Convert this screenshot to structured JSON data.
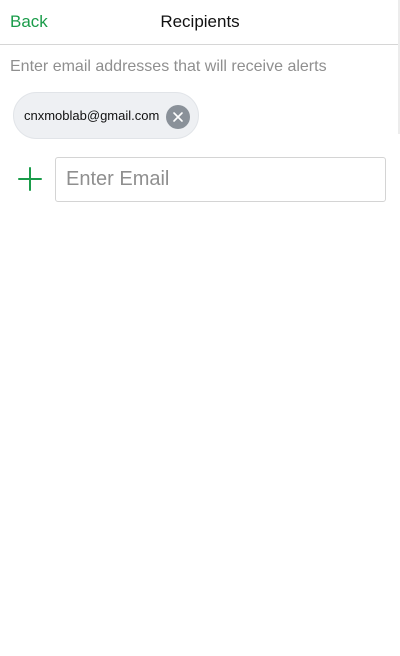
{
  "nav": {
    "back_label": "Back",
    "title": "Recipients"
  },
  "instructions": "Enter email addresses that will receive alerts",
  "recipients": [
    {
      "email": "cnxmoblab@gmail.com"
    }
  ],
  "new_email": {
    "value": "",
    "placeholder": "Enter Email"
  },
  "icons": {
    "remove": "close-icon",
    "add": "plus-icon"
  },
  "colors": {
    "accent": "#1a9c4a",
    "hint_text": "#8f8f8f",
    "chip_bg": "#eef0f3",
    "chip_remove_bg": "#8a9199"
  }
}
